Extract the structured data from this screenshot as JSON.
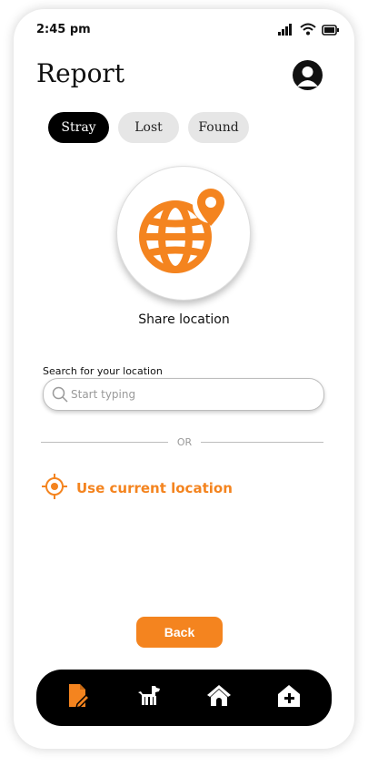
{
  "status_bar": {
    "time": "2:45 pm"
  },
  "header": {
    "title": "Report",
    "profile_icon": "user-avatar-icon"
  },
  "tabs": [
    {
      "label": "Stray",
      "active": true
    },
    {
      "label": "Lost",
      "active": false
    },
    {
      "label": "Found",
      "active": false
    }
  ],
  "hero": {
    "icon": "globe-location-pin-icon",
    "label": "Share location"
  },
  "search": {
    "label": "Search for your location",
    "placeholder": "Start typing",
    "value": ""
  },
  "divider": {
    "text": "OR"
  },
  "use_location": {
    "label": "Use current location",
    "icon": "crosshair-icon"
  },
  "back_button": {
    "label": "Back"
  },
  "bottom_nav": [
    {
      "name": "report",
      "icon": "report-edit-icon",
      "active": true
    },
    {
      "name": "pets",
      "icon": "dog-icon",
      "active": false
    },
    {
      "name": "shelters",
      "icon": "doghouse-icon",
      "active": false
    },
    {
      "name": "add-shelter",
      "icon": "house-plus-icon",
      "active": false
    }
  ],
  "colors": {
    "accent": "#F4841F",
    "dark": "#000000",
    "tab_inactive": "#E6E6E6"
  }
}
